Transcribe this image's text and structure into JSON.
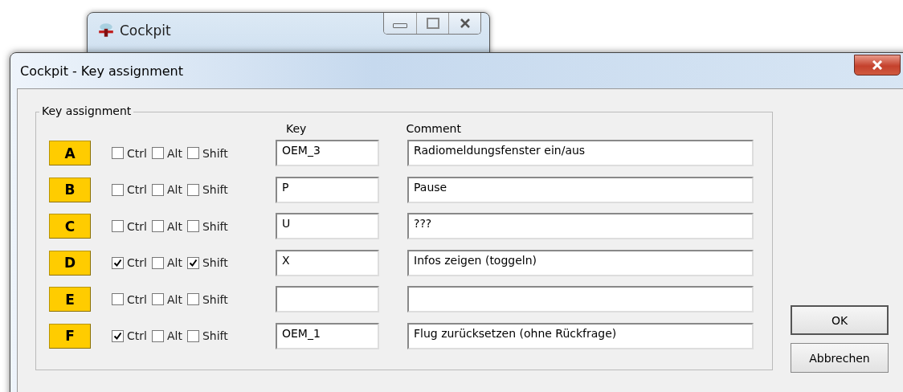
{
  "back_window": {
    "title": "Cockpit"
  },
  "dialog": {
    "title": "Cockpit - Key assignment"
  },
  "group": {
    "title": "Key assignment",
    "column_headers": [
      "Key",
      "Comment"
    ],
    "rows": [
      {
        "letter": "A",
        "modifiers": [
          {
            "label": "Ctrl",
            "checked": false
          },
          {
            "label": "Alt",
            "checked": false
          },
          {
            "label": "Shift",
            "checked": false
          }
        ],
        "key": "OEM_3",
        "comment": "Radiomeldungsfenster ein/aus"
      },
      {
        "letter": "B",
        "modifiers": [
          {
            "label": "Ctrl",
            "checked": false
          },
          {
            "label": "Alt",
            "checked": false
          },
          {
            "label": "Shift",
            "checked": false
          }
        ],
        "key": "P",
        "comment": "Pause"
      },
      {
        "letter": "C",
        "modifiers": [
          {
            "label": "Ctrl",
            "checked": false
          },
          {
            "label": "Alt",
            "checked": false
          },
          {
            "label": "Shift",
            "checked": false
          }
        ],
        "key": "U",
        "comment": "???"
      },
      {
        "letter": "D",
        "modifiers": [
          {
            "label": "Ctrl",
            "checked": true
          },
          {
            "label": "Alt",
            "checked": false
          },
          {
            "label": "Shift",
            "checked": true
          }
        ],
        "key": "X",
        "comment": "Infos zeigen (toggeln)"
      },
      {
        "letter": "E",
        "modifiers": [
          {
            "label": "Ctrl",
            "checked": false
          },
          {
            "label": "Alt",
            "checked": false
          },
          {
            "label": "Shift",
            "checked": false
          }
        ],
        "key": "",
        "comment": ""
      },
      {
        "letter": "F",
        "modifiers": [
          {
            "label": "Ctrl",
            "checked": true
          },
          {
            "label": "Alt",
            "checked": false
          },
          {
            "label": "Shift",
            "checked": false
          }
        ],
        "key": "OEM_1",
        "comment": "Flug zurücksetzen (ohne Rückfrage)"
      }
    ]
  },
  "buttons": [
    "OK",
    "Abbrechen"
  ]
}
